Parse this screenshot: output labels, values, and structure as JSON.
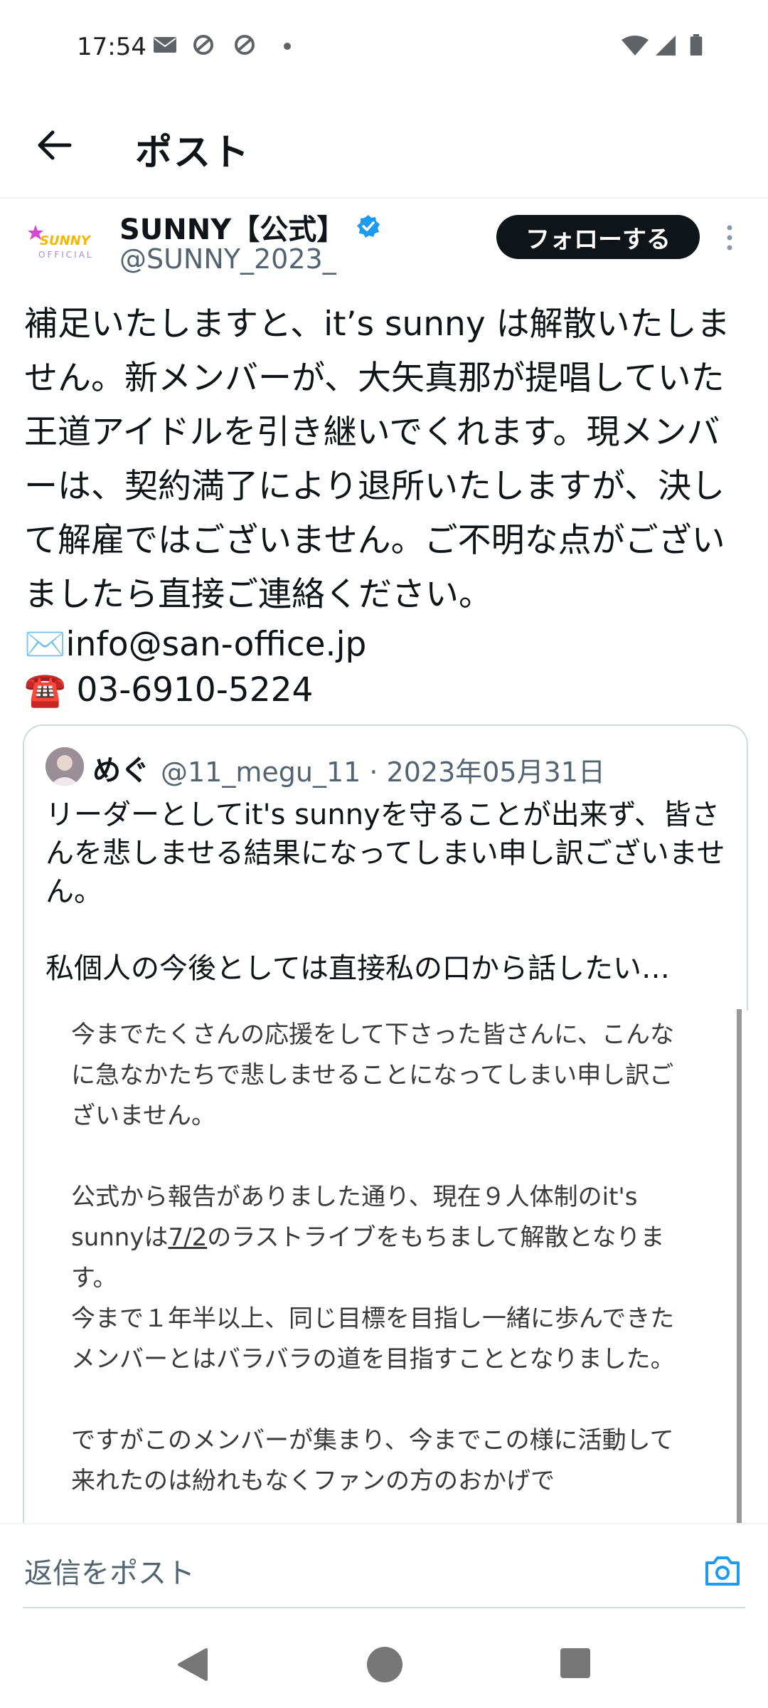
{
  "status_bar": {
    "time": "17:54",
    "icons": [
      "mail-icon",
      "app-icon",
      "app-icon",
      "dot-icon",
      "wifi-icon",
      "signal-icon",
      "battery-icon"
    ]
  },
  "header": {
    "title": "ポスト"
  },
  "post": {
    "author_name": "SUNNY【公式】",
    "handle": "@SUNNY_2023_",
    "follow_label": "フォローする",
    "body": "補足いたしますと、it’s sunny は解散いたしません。新メンバーが、大矢真那が提唱していた王道アイドルを引き継いでくれます。現メンバーは、契約満了により退所いたしますが、決して解雇ではございません。ご不明な点がございましたら直接ご連絡ください。",
    "email_line": "✉️info@san-office.jp",
    "phone_line": "☎️ 03-6910-5224"
  },
  "quote": {
    "name": "めぐ",
    "meta": "@11_megu_11 · 2023年05月31日",
    "text_line1": "リーダーとしてit's sunnyを守ることが出来ず、皆さんを悲しませる結果になってしまい申し訳ございません。",
    "text_line2": "私個人の今後としては直接私の口から話したい…"
  },
  "image_text": {
    "p1": "今までたくさんの応援をして下さった皆さんに、こんなに急なかたちで悲しませることになってしまい申し訳ございません。",
    "p2a": "公式から報告がありました通り、現在９人体制のit's sunnyは",
    "p2_date": "7/2",
    "p2b": "のラストライブをもちまして解散となります。",
    "p3": "今まで１年半以上、同じ目標を目指し一緒に歩んできたメンバーとはバラバラの道を目指すこととなりました。",
    "p4": "ですがこのメンバーが集まり、今までこの様に活動して来れたのは紛れもなくファンの方のおかげで"
  },
  "reply": {
    "placeholder": "返信をポスト"
  },
  "colors": {
    "accent": "#1d9bf0",
    "follow_bg": "#0f1419",
    "muted": "#536471"
  }
}
